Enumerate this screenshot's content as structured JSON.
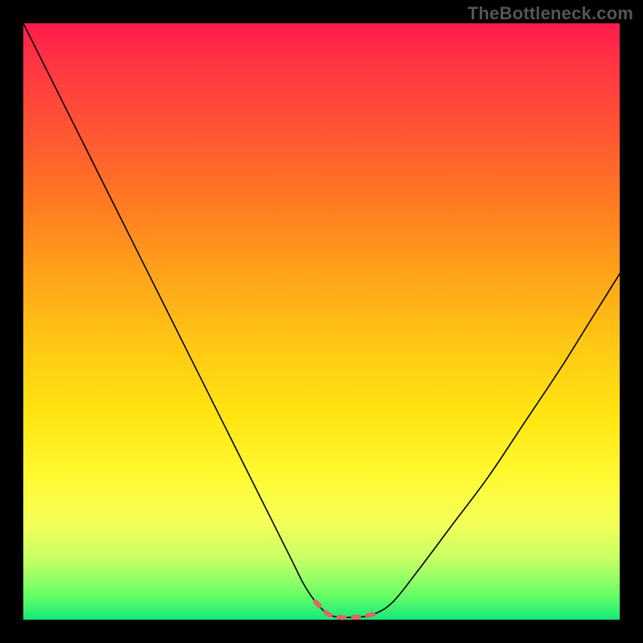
{
  "watermark": "TheBottleneck.com",
  "colors": {
    "page_bg": "#000000",
    "gradient_top": "#ff1a4d",
    "gradient_bottom": "#14e87a",
    "curve": "#000000",
    "marker": "#e06666"
  },
  "chart_data": {
    "type": "line",
    "title": "",
    "xlabel": "",
    "ylabel": "",
    "xlim": [
      0,
      100
    ],
    "ylim": [
      0,
      100
    ],
    "series": [
      {
        "name": "bottleneck-curve",
        "x": [
          0,
          5,
          10,
          15,
          20,
          25,
          30,
          35,
          40,
          45,
          47,
          49,
          51,
          53,
          55,
          57,
          59,
          62,
          66,
          72,
          78,
          84,
          90,
          95,
          100
        ],
        "y": [
          100,
          90,
          80,
          70,
          60,
          50,
          40,
          30,
          20,
          10,
          6,
          3,
          1,
          0.4,
          0.4,
          0.5,
          1,
          3,
          8,
          16,
          24,
          33,
          42,
          50,
          58
        ]
      }
    ],
    "markers": {
      "name": "optimal-range",
      "x": [
        49,
        51,
        53,
        55,
        57,
        59
      ],
      "y": [
        3,
        1,
        0.4,
        0.4,
        0.5,
        1
      ]
    }
  }
}
